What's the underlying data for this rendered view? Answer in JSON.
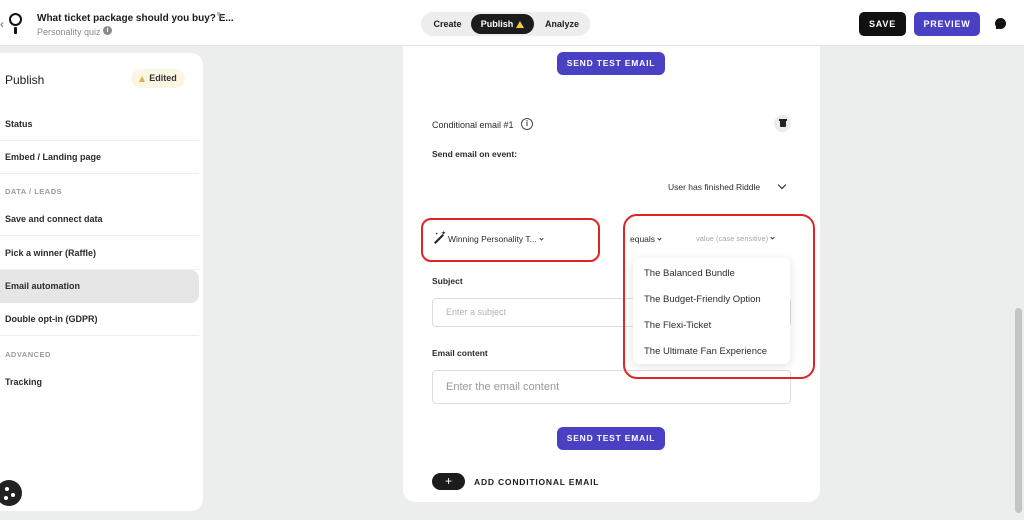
{
  "header": {
    "quiz_title": "What ticket package should you buy? E...",
    "quiz_type": "Personality quiz",
    "modes": {
      "create": "Create",
      "publish": "Publish",
      "analyze": "Analyze"
    },
    "save_label": "SAVE",
    "preview_label": "PREVIEW"
  },
  "sidebar": {
    "title": "Publish",
    "badge": "Edited",
    "items": {
      "status": "Status",
      "embed": "Embed / Landing page",
      "section_data": "DATA / LEADS",
      "save_connect": "Save and connect data",
      "pick_winner": "Pick a winner (Raffle)",
      "email_automation": "Email automation",
      "double_optin": "Double opt-in (GDPR)",
      "section_advanced": "ADVANCED",
      "tracking": "Tracking"
    }
  },
  "main": {
    "send_test_label": "SEND TEST EMAIL",
    "conditional_title": "Conditional email #1",
    "event_label": "Send email on event:",
    "event_value": "User has finished Riddle",
    "condition_field": "Winning Personality T...",
    "operator": "equals",
    "value_placeholder": "value (case sensitive)",
    "subject_label": "Subject",
    "subject_placeholder": "Enter a subject",
    "content_label": "Email content",
    "content_placeholder": "Enter the email content",
    "add_conditional_label": "ADD CONDITIONAL EMAIL"
  },
  "dropdown": {
    "options": [
      "The Balanced Bundle",
      "The Budget-Friendly Option",
      "The Flexi-Ticket",
      "The Ultimate Fan Experience"
    ]
  },
  "colors": {
    "accent": "#4a40c4",
    "highlight": "#e02424",
    "warning": "#f2c94c"
  }
}
